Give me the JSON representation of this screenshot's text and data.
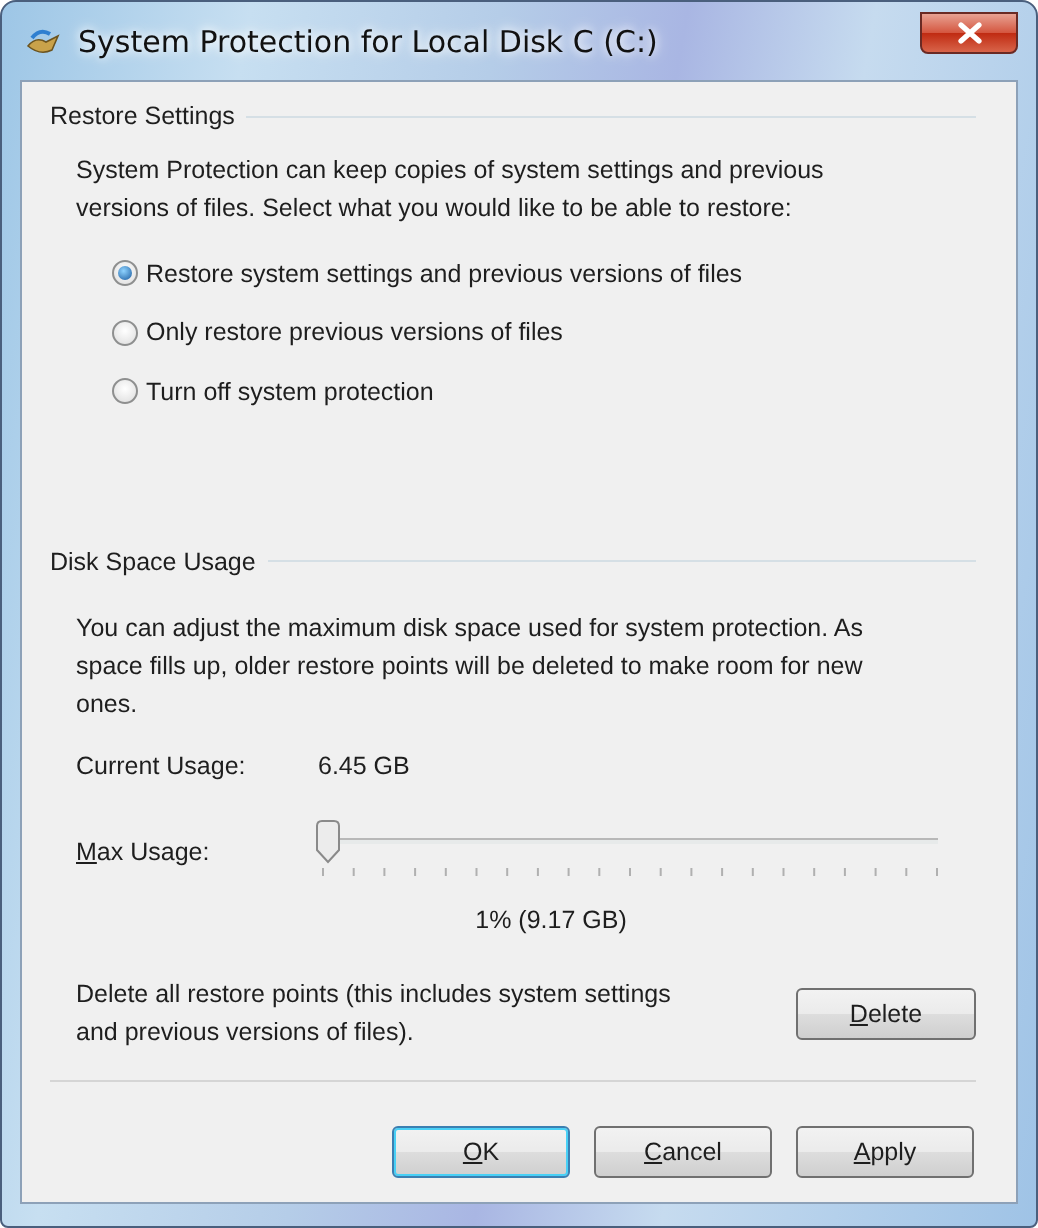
{
  "window": {
    "title": "System Protection for Local Disk C (C:)"
  },
  "restore_settings": {
    "heading": "Restore Settings",
    "description": "System Protection can keep copies of system settings and previous versions of files. Select what you would like to be able to restore:",
    "options": [
      {
        "label": "Restore system settings and previous versions of files",
        "selected": true
      },
      {
        "label": "Only restore previous versions of files",
        "selected": false
      },
      {
        "label": "Turn off system protection",
        "selected": false
      }
    ]
  },
  "disk_space_usage": {
    "heading": "Disk Space Usage",
    "description": "You can adjust the maximum disk space used for system protection. As space fills up, older restore points will be deleted to make room for new ones.",
    "current_usage": {
      "label": "Current Usage:",
      "value": "6.45 GB"
    },
    "max_usage": {
      "label": "Max Usage:",
      "level": 0.01,
      "reading": "1% (9.17 GB)"
    }
  },
  "delete_restore_points": {
    "description": "Delete all restore points (this includes system settings and previous versions of files).",
    "button": "Delete"
  },
  "buttons": [
    {
      "label": "OK",
      "default": true
    },
    {
      "label": "Cancel",
      "default": false
    },
    {
      "label": "Apply",
      "default": false
    }
  ]
}
